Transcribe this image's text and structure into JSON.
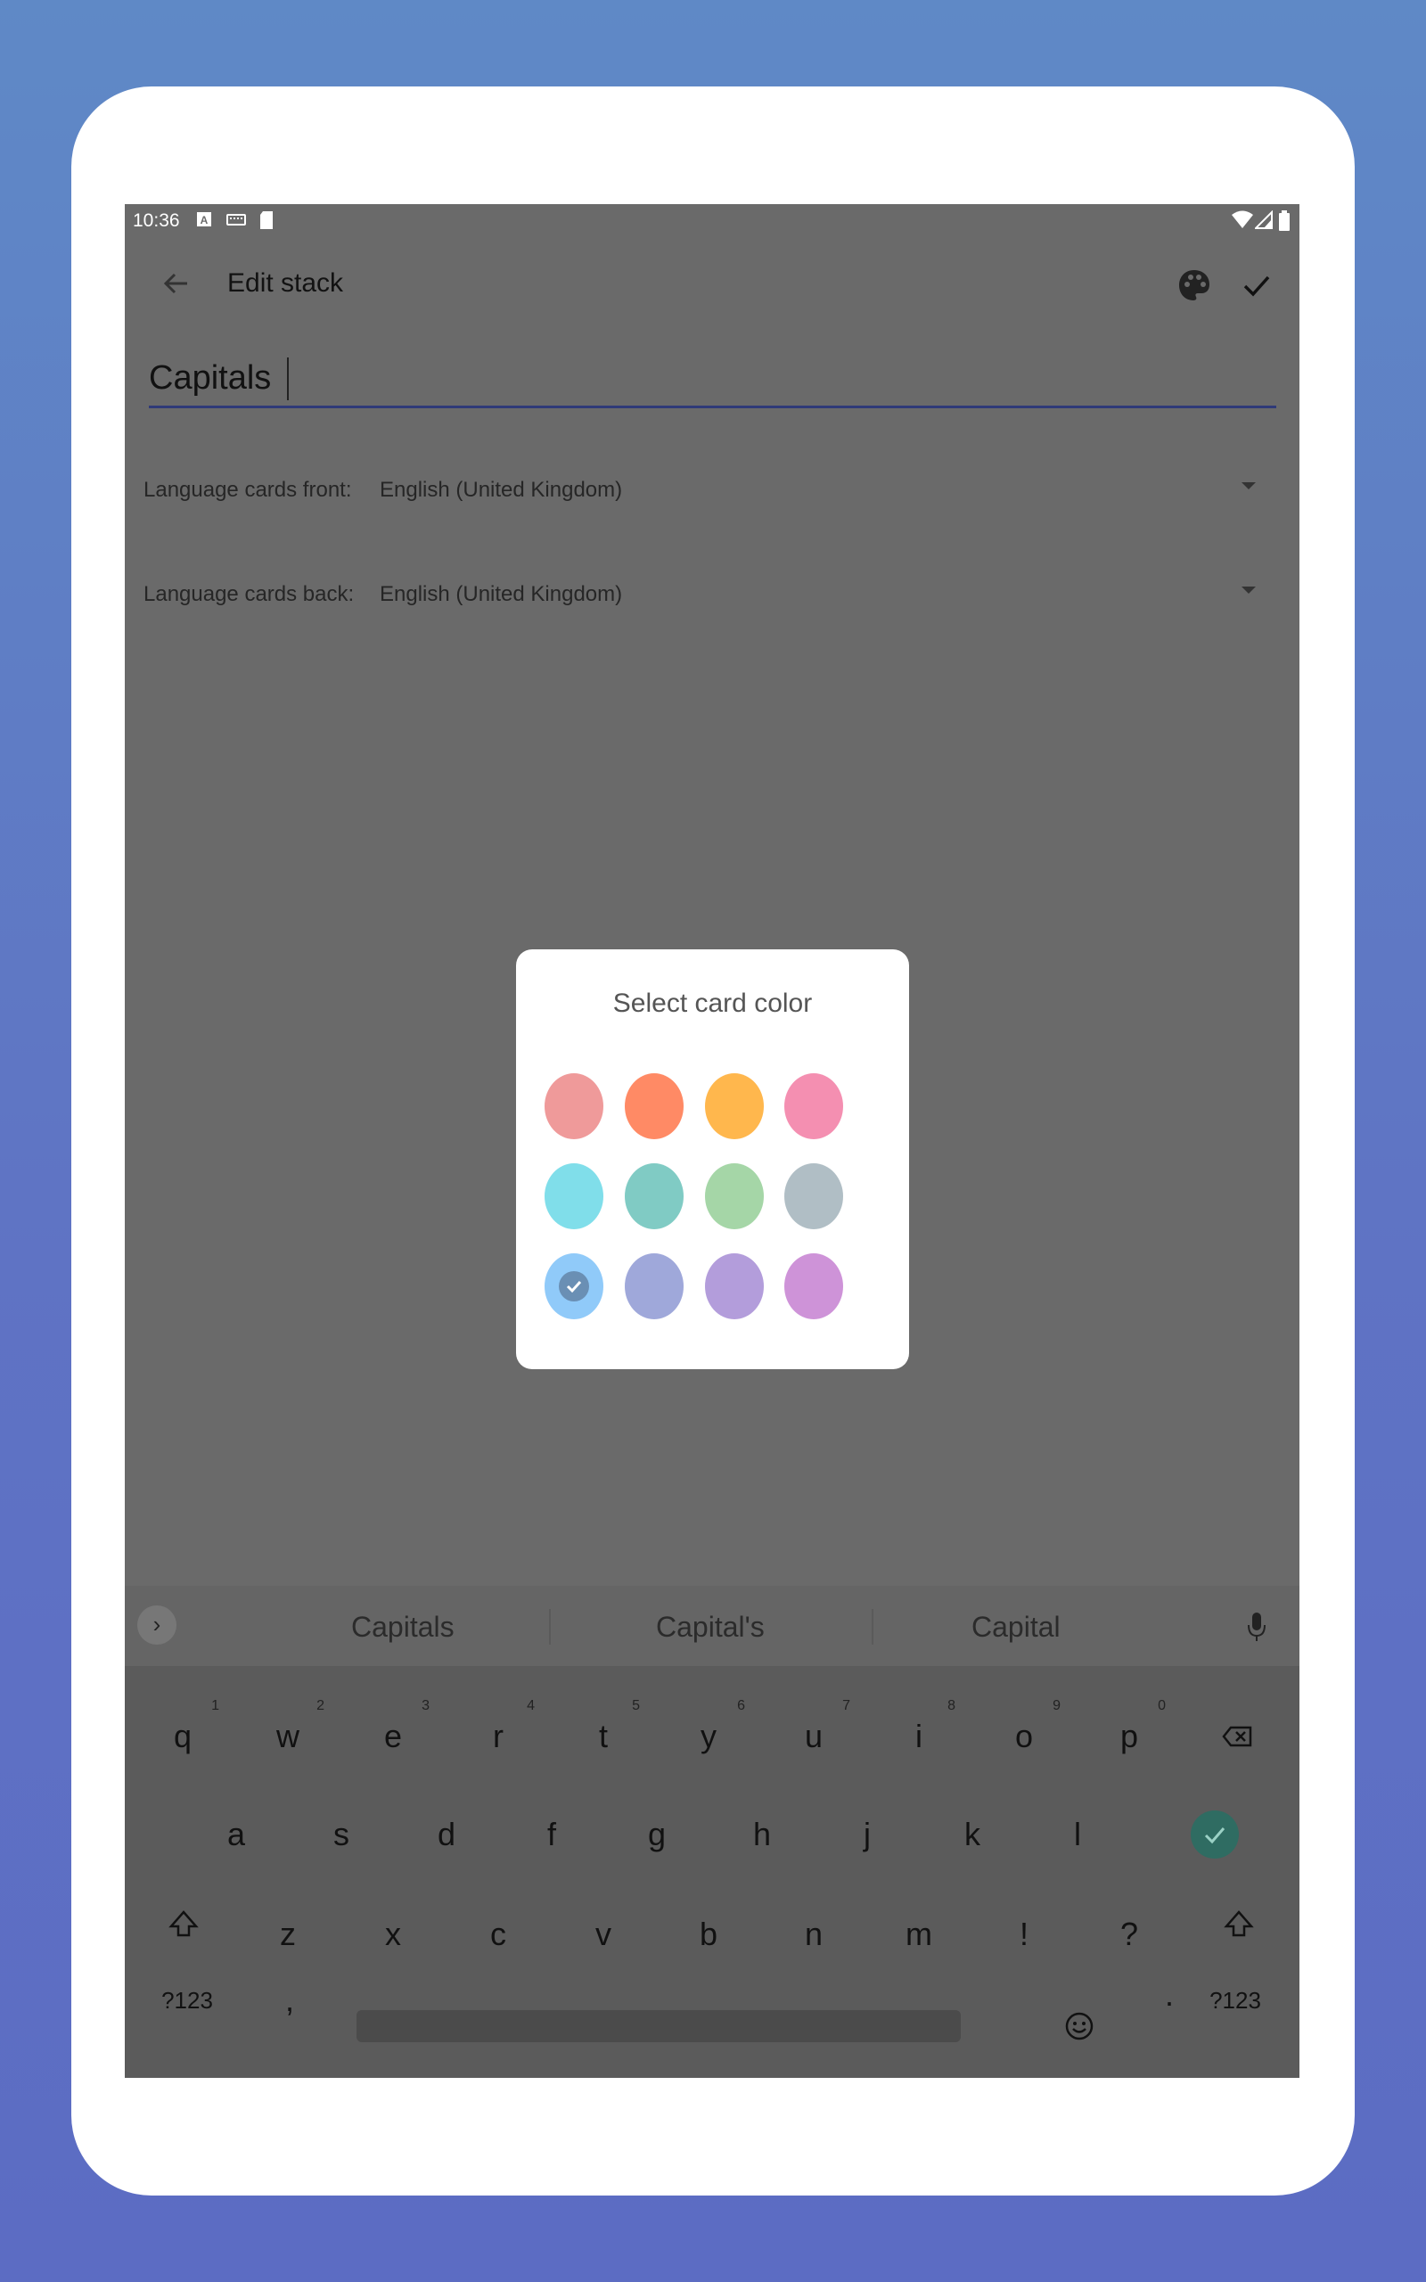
{
  "status_bar": {
    "time": "10:36"
  },
  "app_bar": {
    "title": "Edit stack"
  },
  "stack_name": {
    "value": "Capitals"
  },
  "languages": {
    "front_label": "Language cards front:",
    "front_value": "English (United Kingdom)",
    "back_label": "Language cards back:",
    "back_value": "English (United Kingdom)"
  },
  "color_dialog": {
    "title": "Select card color",
    "colors": [
      "#ef9a9a",
      "#ff8a65",
      "#ffb74d",
      "#f48fb1",
      "#80deea",
      "#80cbc4",
      "#a5d6a7",
      "#b0bec5",
      "#90caf9",
      "#9fa8da",
      "#b39ddb",
      "#ce93d8"
    ],
    "selected_index": 8
  },
  "keyboard": {
    "suggestions": [
      "Capitals",
      "Capital's",
      "Capital"
    ],
    "row1": [
      {
        "key": "q",
        "hint": "1"
      },
      {
        "key": "w",
        "hint": "2"
      },
      {
        "key": "e",
        "hint": "3"
      },
      {
        "key": "r",
        "hint": "4"
      },
      {
        "key": "t",
        "hint": "5"
      },
      {
        "key": "y",
        "hint": "6"
      },
      {
        "key": "u",
        "hint": "7"
      },
      {
        "key": "i",
        "hint": "8"
      },
      {
        "key": "o",
        "hint": "9"
      },
      {
        "key": "p",
        "hint": "0"
      }
    ],
    "row2": [
      "a",
      "s",
      "d",
      "f",
      "g",
      "h",
      "j",
      "k",
      "l"
    ],
    "row3": [
      "z",
      "x",
      "c",
      "v",
      "b",
      "n",
      "m",
      "!",
      "?"
    ],
    "symbols_label": "?123",
    "comma": ",",
    "period": "."
  }
}
